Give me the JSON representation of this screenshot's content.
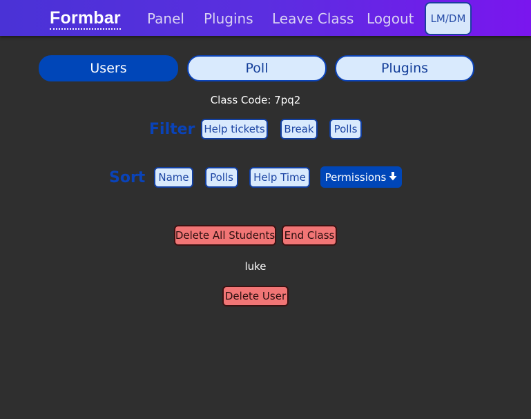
{
  "nav": {
    "brand": "Formbar",
    "links": [
      "Panel",
      "Plugins",
      "Leave Class",
      "Logout"
    ],
    "theme_toggle": "LM/DM"
  },
  "tabs": [
    {
      "label": "Users",
      "active": true
    },
    {
      "label": "Poll",
      "active": false
    },
    {
      "label": "Plugins",
      "active": false
    }
  ],
  "class_code": "Class Code: 7pq2",
  "filter": {
    "label": "Filter",
    "options": [
      "Help tickets",
      "Break",
      "Polls"
    ]
  },
  "sort": {
    "label": "Sort",
    "options": [
      "Name",
      "Polls",
      "Help Time",
      "Permissions"
    ],
    "active": "Permissions",
    "active_icon": "arrow-down-icon"
  },
  "actions": {
    "delete_all": "Delete All Students",
    "end_class": "End Class"
  },
  "users": [
    {
      "name": "luke",
      "delete_label": "Delete User"
    }
  ],
  "colors": {
    "background": "#2f2f2f",
    "nav_gradient_start": "#4a32d6",
    "nav_gradient_end": "#7a16ee",
    "primary": "#0046b8",
    "chip_bg": "#d9eafd",
    "danger": "#f17575"
  }
}
